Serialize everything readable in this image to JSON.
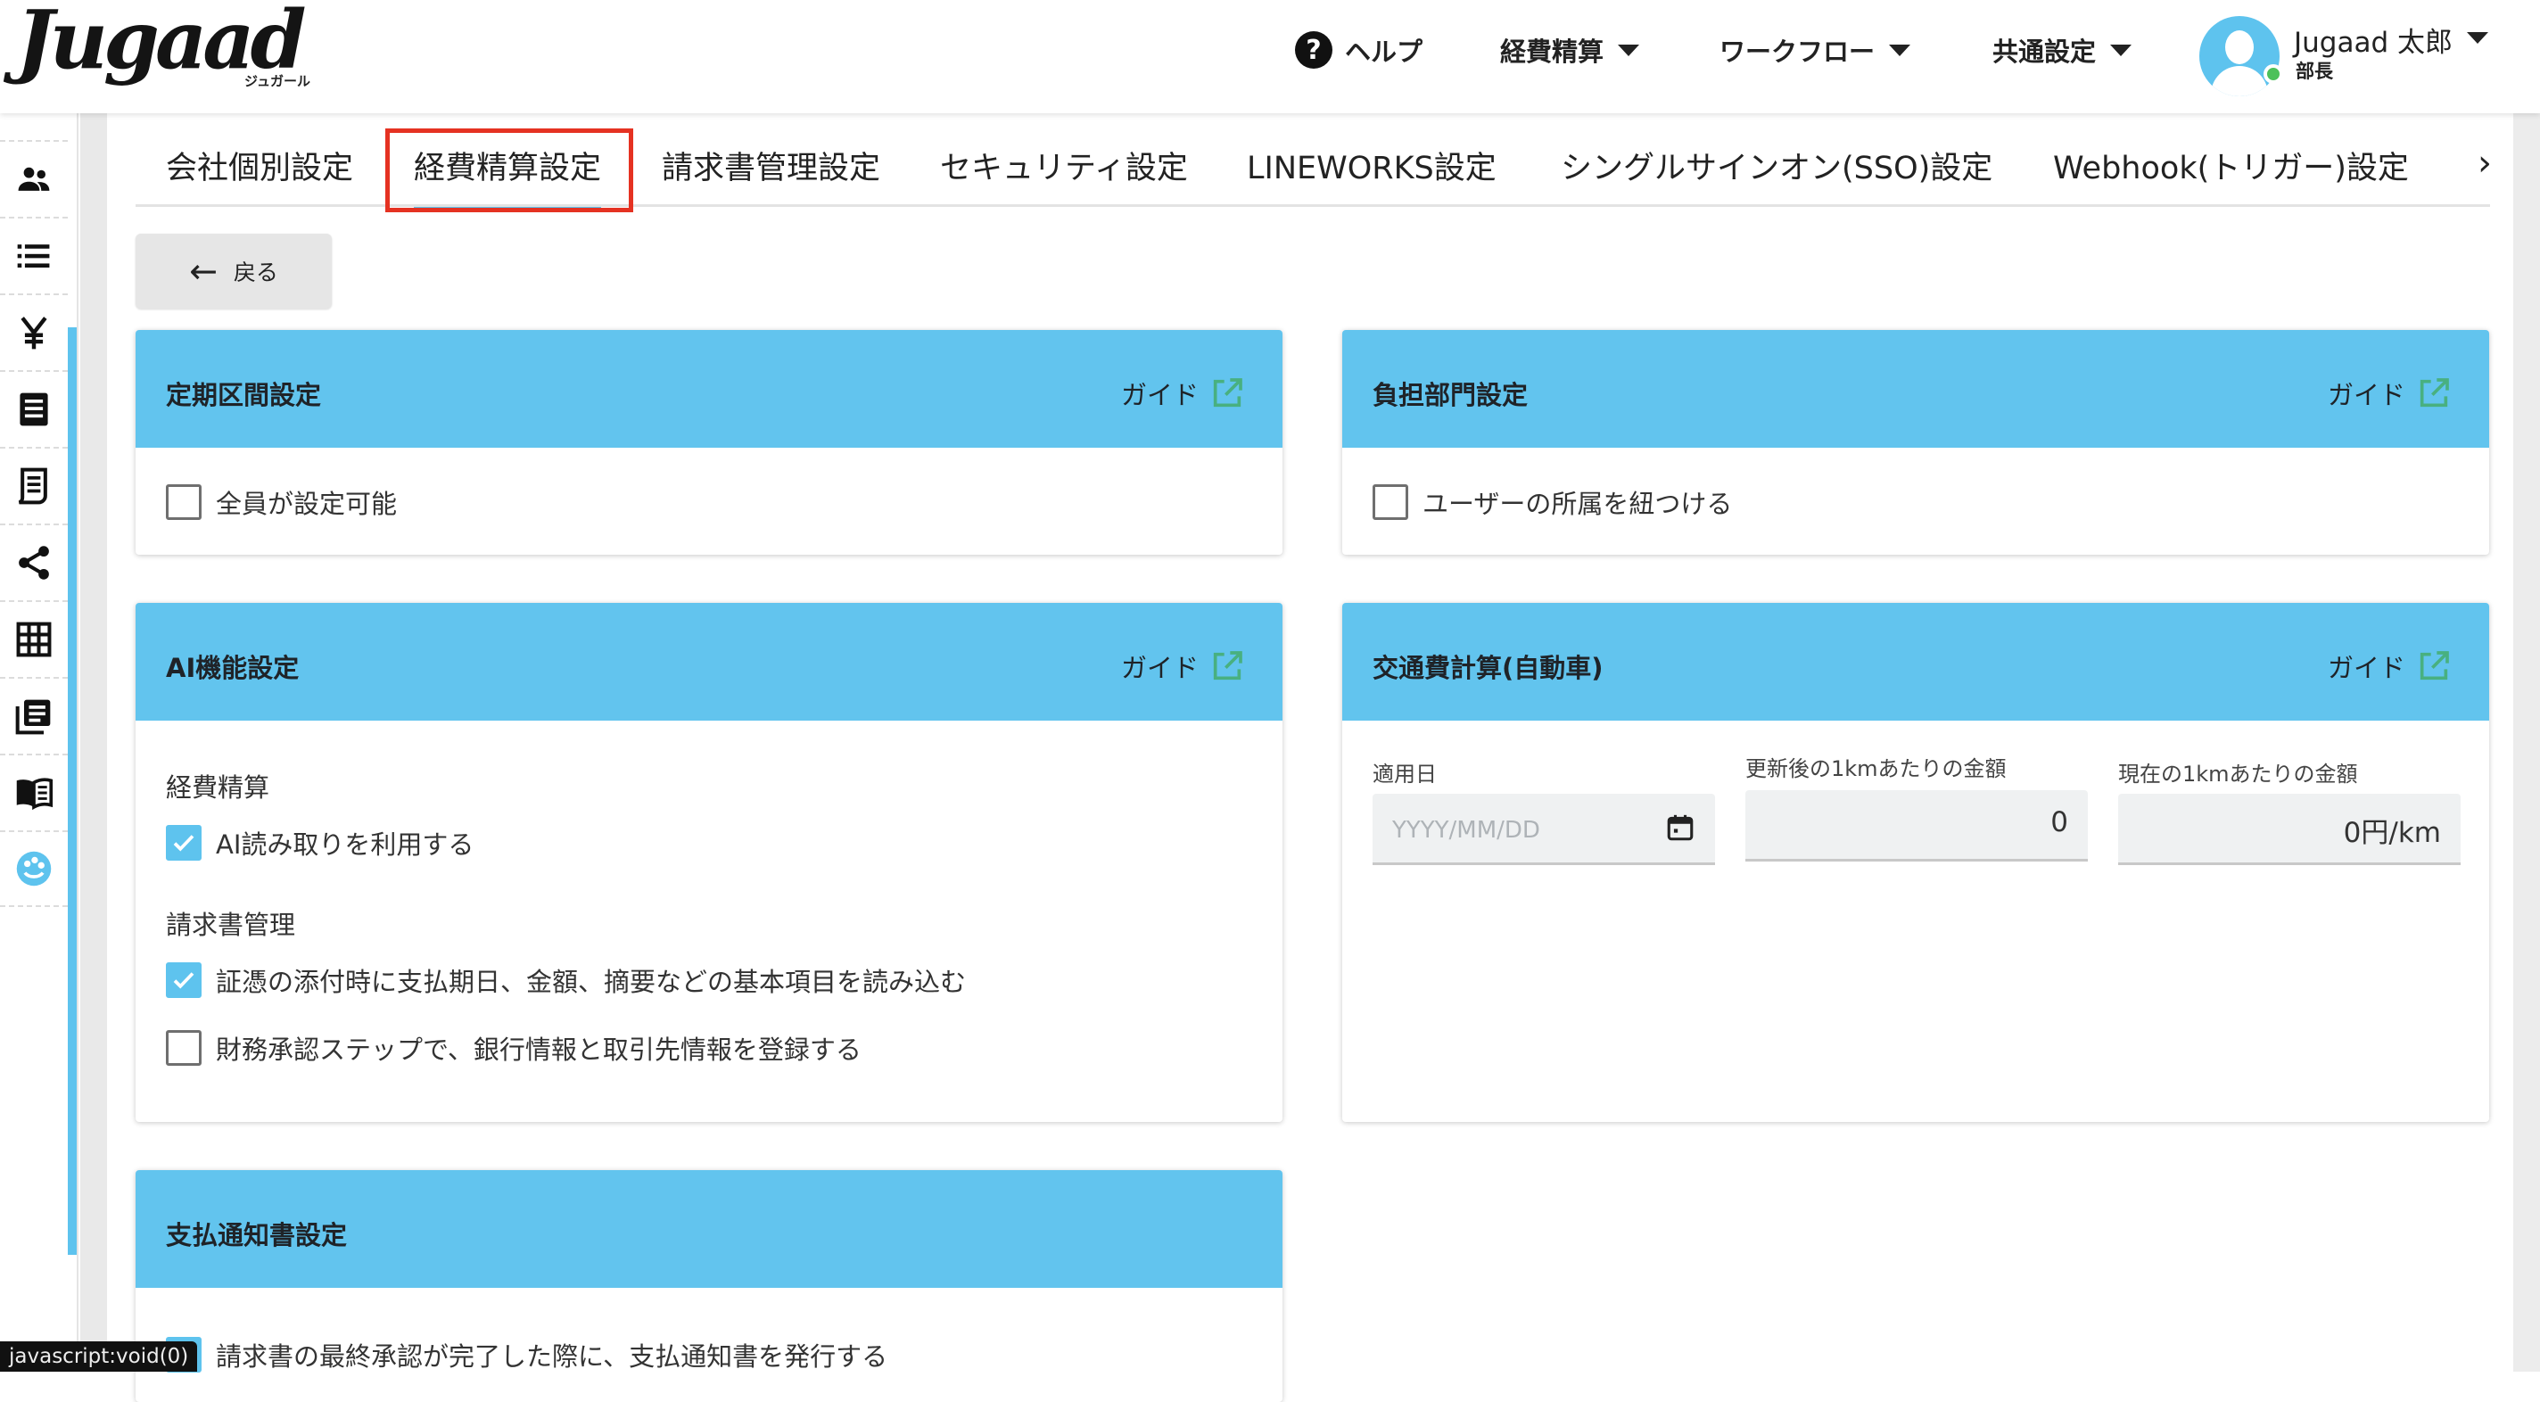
{
  "header": {
    "logo_text": "Jugaad",
    "logo_sub": "ジュガール",
    "nav": {
      "help": "ヘルプ",
      "expense": "経費精算",
      "workflow": "ワークフロー",
      "common": "共通設定"
    },
    "user": {
      "name": "Jugaad 太郎",
      "role": "部長",
      "status_color": "#4cc15a"
    }
  },
  "sidebar": {
    "icons": [
      "users-icon",
      "list-icon",
      "yen-icon",
      "document-icon",
      "receipt-icon",
      "share-icon",
      "grid-icon",
      "library-icon",
      "book-icon",
      "palette-icon"
    ]
  },
  "tabs": [
    "会社個別設定",
    "経費精算設定",
    "請求書管理設定",
    "セキュリティ設定",
    "LINEWORKS設定",
    "シングルサインオン(SSO)設定",
    "Webhook(トリガー)設定"
  ],
  "active_tab": "経費精算設定",
  "back_button": "戻る",
  "guide_label": "ガイド",
  "cards": {
    "teiki": {
      "title": "定期区間設定",
      "option": {
        "label": "全員が設定可能",
        "checked": false
      }
    },
    "futan": {
      "title": "負担部門設定",
      "option": {
        "label": "ユーザーの所属を紐つける",
        "checked": false
      }
    },
    "ai": {
      "title": "AI機能設定",
      "section1": "経費精算",
      "option1": {
        "label": "AI読み取りを利用する",
        "checked": true
      },
      "section2": "請求書管理",
      "option2": {
        "label": "証憑の添付時に支払期日、金額、摘要などの基本項目を読み込む",
        "checked": true
      },
      "option3": {
        "label": "財務承認ステップで、銀行情報と取引先情報を登録する",
        "checked": false
      }
    },
    "kotsu": {
      "title": "交通費計算(自動車)",
      "date_label": "適用日",
      "date_placeholder": "YYYY/MM/DD",
      "new_rate_label": "更新後の1kmあたりの金額",
      "new_rate_value": "0",
      "current_rate_label": "現在の1kmあたりの金額",
      "current_rate_value": "0円/km"
    },
    "shiharai": {
      "title": "支払通知書設定",
      "option": {
        "label": "請求書の最終承認が完了した際に、支払通知書を発行する",
        "checked": true
      }
    }
  },
  "status_bar": "javascript:void(0)",
  "colors": {
    "accent": "#5ec3ee",
    "card_header": "#62c4ee",
    "highlight": "#e53222"
  }
}
